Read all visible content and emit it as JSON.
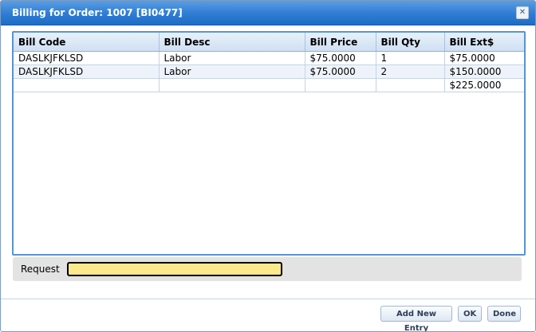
{
  "window": {
    "title": "Billing for Order: 1007 [BI0477]",
    "close_glyph": "✕"
  },
  "grid": {
    "columns": [
      "Bill Code",
      "Bill Desc",
      "Bill Price",
      "Bill Qty",
      "Bill Ext$"
    ],
    "rows": [
      [
        "DASLKJFKLSD",
        "Labor",
        "$75.0000",
        "1",
        "$75.0000"
      ],
      [
        "DASLKJFKLSD",
        "Labor",
        "$75.0000",
        "2",
        "$150.0000"
      ],
      [
        "",
        "",
        "",
        "",
        "$225.0000"
      ]
    ]
  },
  "request": {
    "label": "Request",
    "value": "",
    "placeholder": ""
  },
  "buttons": {
    "add_new_entry": "Add New Entry",
    "ok": "OK",
    "done": "Done"
  }
}
